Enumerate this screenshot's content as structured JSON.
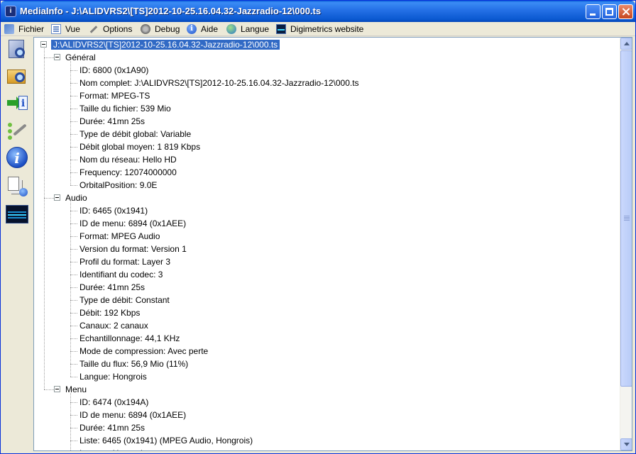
{
  "window": {
    "title": "MediaInfo - J:\\ALIDVRS2\\[TS]2012-10-25.16.04.32-Jazzradio-12\\000.ts",
    "icon_text": "i"
  },
  "menu": [
    {
      "label": "Fichier",
      "icon": "file-icon"
    },
    {
      "label": "Vue",
      "icon": "view-icon"
    },
    {
      "label": "Options",
      "icon": "options-icon"
    },
    {
      "label": "Debug",
      "icon": "debug-icon"
    },
    {
      "label": "Aide",
      "icon": "help-icon"
    },
    {
      "label": "Langue",
      "icon": "globe-icon"
    },
    {
      "label": "Digimetrics website",
      "icon": "digimetrics-icon"
    }
  ],
  "sidebar": [
    {
      "name": "open-file-icon"
    },
    {
      "name": "open-folder-icon"
    },
    {
      "name": "export-icon"
    },
    {
      "name": "preferences-icon"
    },
    {
      "name": "about-icon"
    },
    {
      "name": "sheet-icon"
    },
    {
      "name": "digimetrics-tool-icon"
    }
  ],
  "tree": {
    "root": "J:\\ALIDVRS2\\[TS]2012-10-25.16.04.32-Jazzradio-12\\000.ts",
    "sections": [
      {
        "name": "Général",
        "items": [
          "ID: 6800 (0x1A90)",
          "Nom complet: J:\\ALIDVRS2\\[TS]2012-10-25.16.04.32-Jazzradio-12\\000.ts",
          "Format: MPEG-TS",
          "Taille du fichier: 539 Mio",
          "Durée: 41mn 25s",
          "Type de débit global: Variable",
          "Débit global moyen: 1 819 Kbps",
          "Nom du réseau: Hello HD",
          "Frequency: 12074000000",
          "OrbitalPosition: 9.0E"
        ]
      },
      {
        "name": "Audio",
        "items": [
          "ID: 6465 (0x1941)",
          "ID de menu: 6894 (0x1AEE)",
          "Format: MPEG Audio",
          "Version du format: Version 1",
          "Profil du format: Layer 3",
          "Identifiant du codec: 3",
          "Durée: 41mn 25s",
          "Type de débit: Constant",
          "Débit: 192 Kbps",
          "Canaux: 2 canaux",
          "Echantillonnage: 44,1 KHz",
          "Mode de compression: Avec perte",
          "Taille du flux: 56,9 Mio (11%)",
          "Langue: Hongrois"
        ]
      },
      {
        "name": "Menu",
        "items": [
          "ID: 6474 (0x194A)",
          "ID de menu: 6894 (0x1AEE)",
          "Durée: 41mn 25s",
          "Liste: 6465 (0x1941) (MPEG Audio, Hongrois)",
          "Langue: Hongrois"
        ]
      }
    ]
  }
}
